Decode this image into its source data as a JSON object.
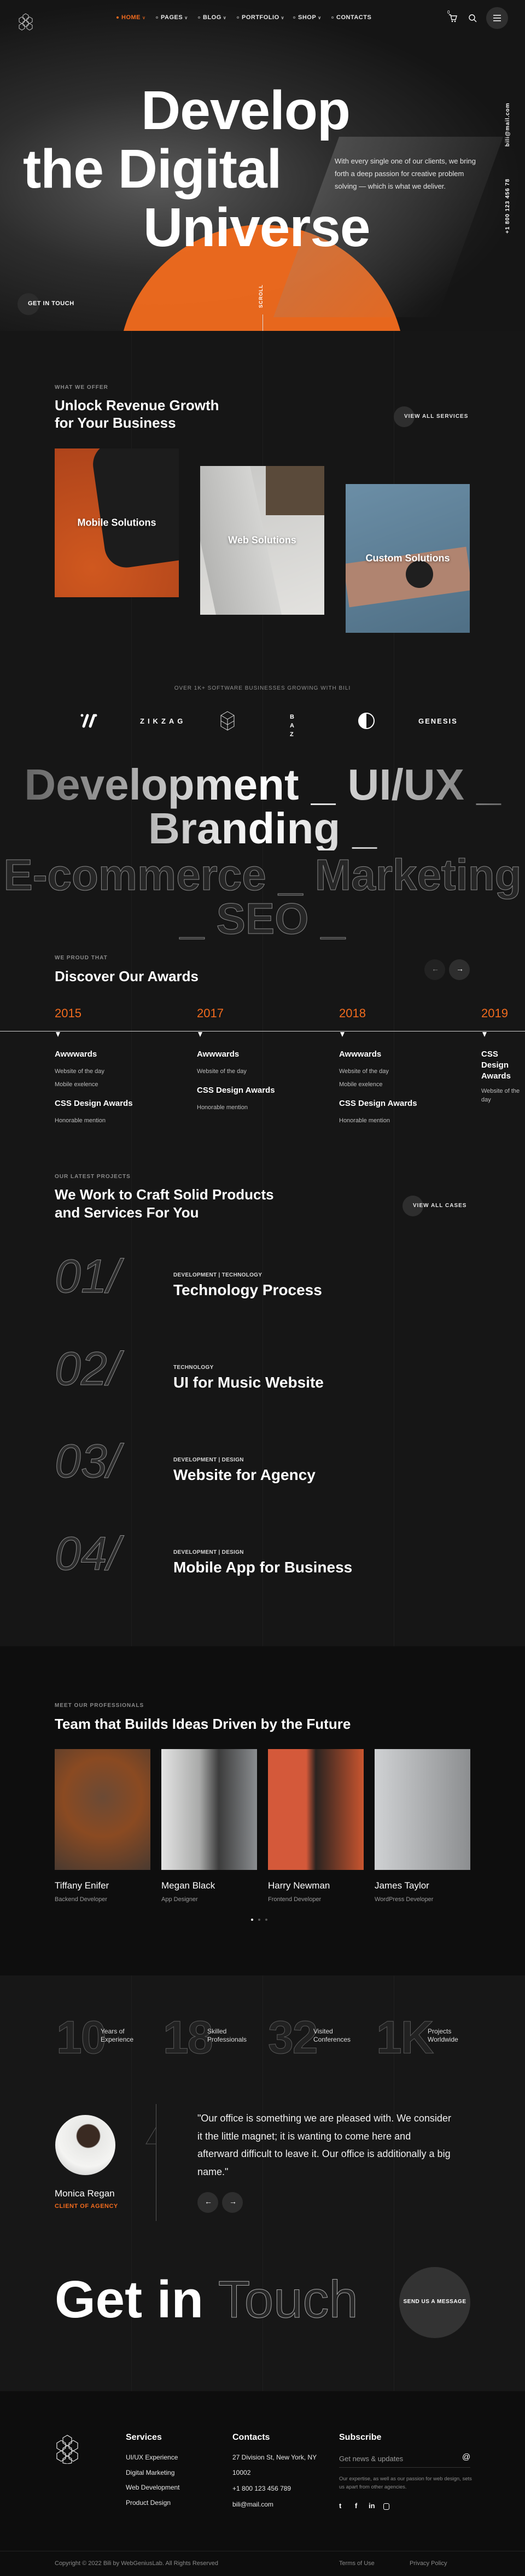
{
  "brand": {
    "accent": "#f26b1d",
    "logo_icon": "isometric-cubes-logo"
  },
  "nav": {
    "items": [
      {
        "label": "HOME",
        "active": true,
        "has_dropdown": true
      },
      {
        "label": "PAGES",
        "active": false,
        "has_dropdown": true
      },
      {
        "label": "BLOG",
        "active": false,
        "has_dropdown": true
      },
      {
        "label": "PORTFOLIO",
        "active": false,
        "has_dropdown": true
      },
      {
        "label": "SHOP",
        "active": false,
        "has_dropdown": true
      },
      {
        "label": "CONTACTS",
        "active": false,
        "has_dropdown": false
      }
    ],
    "cart_count": "0",
    "icons": [
      "cart-icon",
      "search-icon",
      "menu-icon"
    ]
  },
  "hero": {
    "title_lines": [
      "Develop",
      "the Digital",
      "Universe"
    ],
    "description": "With every single one of our clients, we bring forth a deep passion for creative problem solving — which is what we deliver.",
    "email": "bili@mail.com",
    "phone": "+1 800 123 456 78",
    "cta": "GET IN TOUCH",
    "scroll": "SCROLL"
  },
  "services": {
    "eyebrow": "WHAT WE OFFER",
    "title_lines": [
      "Unlock Revenue Growth",
      "for Your Business"
    ],
    "view_all": "VIEW ALL SERVICES",
    "cards": [
      {
        "label": "Mobile Solutions"
      },
      {
        "label": "Web Solutions"
      },
      {
        "label": "Custom Solutions"
      }
    ]
  },
  "clients": {
    "caption": "OVER 1K+ SOFTWARE BUSINESSES GROWING WITH BILI",
    "logos": [
      "stripes-logo",
      "ZIKZAG",
      "cubes-logo",
      "BAZ",
      "half-circle-logo",
      "GENESIS"
    ]
  },
  "marquee": {
    "row1": "Development _ UI/UX _ Branding _",
    "row2": "E-commerce _ Marketing _ SEO _"
  },
  "awards": {
    "eyebrow": "WE PROUD THAT",
    "title": "Discover Our Awards",
    "columns": [
      {
        "year": "2015",
        "groups": [
          {
            "title": "Awwwards",
            "items": [
              "Website of the day",
              "Mobile exelence"
            ]
          },
          {
            "title": "CSS Design Awards",
            "items": [
              "Honorable mention"
            ]
          }
        ]
      },
      {
        "year": "2017",
        "groups": [
          {
            "title": "Awwwards",
            "items": [
              "Website of the day"
            ]
          },
          {
            "title": "CSS Design Awards",
            "items": [
              "Honorable mention"
            ]
          }
        ]
      },
      {
        "year": "2018",
        "groups": [
          {
            "title": "Awwwards",
            "items": [
              "Website of the day",
              "Mobile exelence"
            ]
          },
          {
            "title": "CSS Design Awards",
            "items": [
              "Honorable mention"
            ]
          }
        ]
      },
      {
        "year": "2019",
        "groups": [
          {
            "title": "CSS Design Awards",
            "items": [
              "Website of the day"
            ]
          }
        ]
      }
    ]
  },
  "projects": {
    "eyebrow": "OUR LATEST PROJECTS",
    "title_lines": [
      "We Work to Craft Solid Products",
      "and Services For You"
    ],
    "view_all": "VIEW ALL CASES",
    "items": [
      {
        "number": "01/",
        "category": "DEVELOPMENT | TECHNOLOGY",
        "title": "Technology Process"
      },
      {
        "number": "02/",
        "category": "TECHNOLOGY",
        "title": "UI for Music Website"
      },
      {
        "number": "03/",
        "category": "DEVELOPMENT | DESIGN",
        "title": "Website for Agency"
      },
      {
        "number": "04/",
        "category": "DEVELOPMENT | DESIGN",
        "title": "Mobile App for Business"
      }
    ]
  },
  "team": {
    "eyebrow": "MEET OUR PROFESSIONALS",
    "title": "Team that Builds Ideas Driven by the Future",
    "members": [
      {
        "name": "Tiffany Enifer",
        "role": "Backend Developer"
      },
      {
        "name": "Megan Black",
        "role": "App Designer"
      },
      {
        "name": "Harry Newman",
        "role": "Frontend Developer"
      },
      {
        "name": "James Taylor",
        "role": "WordPress Developer"
      }
    ],
    "pages": 3,
    "active_page": 1
  },
  "stats": [
    {
      "value": "10",
      "label_lines": [
        "Years of",
        "Experience"
      ]
    },
    {
      "value": "18",
      "label_lines": [
        "Skilled",
        "Professionals"
      ]
    },
    {
      "value": "32",
      "label_lines": [
        "Visited",
        "Conferences"
      ]
    },
    {
      "value": "1K",
      "label_lines": [
        "Projects",
        "Worldwide"
      ]
    }
  ],
  "testimonial": {
    "quote": "\"Our office is something we are pleased with. We consider it the little magnet; it is wanting to come here and afterward difficult to leave it. Our office is additionally a big name.\"",
    "name": "Monica Regan",
    "role": "CLIENT OF AGENCY"
  },
  "contact": {
    "title_solid": "Get in",
    "title_outline": "Touch",
    "button": "SEND US A MESSAGE"
  },
  "footer": {
    "services": {
      "heading": "Services",
      "items": [
        "UI/UX Experience",
        "Digital Marketing",
        "Web Development",
        "Product Design"
      ]
    },
    "contacts": {
      "heading": "Contacts",
      "items": [
        "27 Division St, New York, NY",
        "10002",
        "+1 800 123 456 789",
        "bili@mail.com"
      ]
    },
    "subscribe": {
      "heading": "Subscribe",
      "placeholder": "Get news & updates",
      "description": "Our expertise, as well as our passion for web design, sets us apart from other agencies.",
      "socials": [
        "twitter-icon",
        "facebook-icon",
        "linkedin-icon",
        "instagram-icon"
      ]
    },
    "copyright": "Copyright © 2022 Bili by WebGeniusLab. All Rights Reserved",
    "links": [
      "Terms of Use",
      "Privacy Policy"
    ]
  }
}
